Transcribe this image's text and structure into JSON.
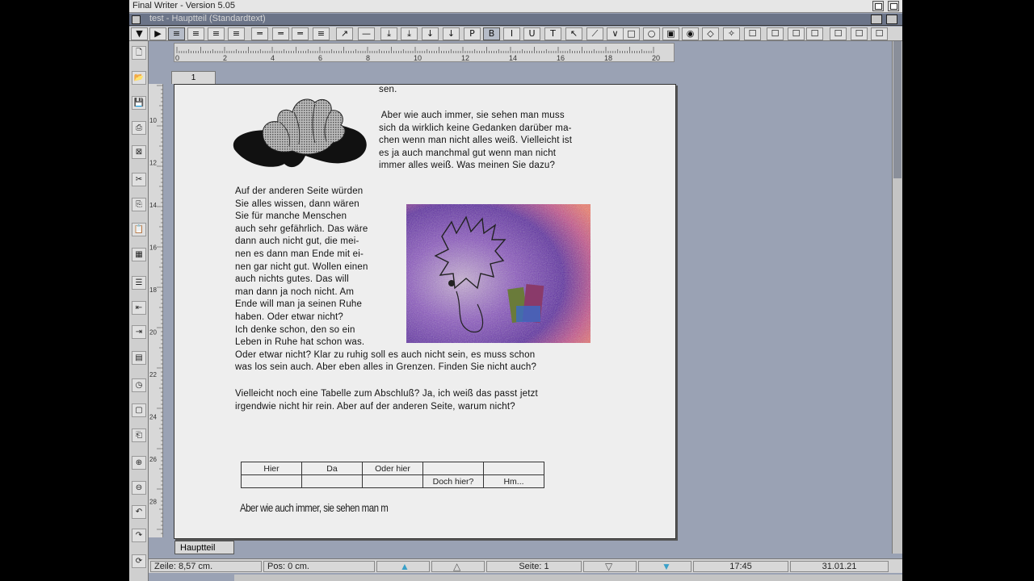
{
  "window": {
    "title": "Final Writer - Version 5.05"
  },
  "document": {
    "title": "test - Hauptteil (Standardtext)"
  },
  "toolbar": {
    "items": [
      "▼",
      "▶",
      "≡",
      "≡",
      "≡",
      "≡",
      "═",
      "═",
      "═",
      "≡",
      "↗",
      "—",
      "⤓",
      "⤓",
      "↓",
      "↓",
      "P",
      "B",
      "I",
      "U",
      "T",
      "↖",
      "⟋",
      "∨",
      "□",
      "○",
      "▣",
      "◉",
      "◇",
      "✧",
      "☐",
      "☐",
      "☐",
      "☐",
      "☐",
      "☐",
      "☐"
    ]
  },
  "ruler": {
    "labels": [
      "0",
      "2",
      "4",
      "6",
      "8",
      "10",
      "12",
      "14",
      "16",
      "18",
      "20"
    ]
  },
  "vruler": {
    "labels": [
      "10",
      "12",
      "14",
      "16",
      "18",
      "20",
      "22",
      "24",
      "26",
      "28"
    ]
  },
  "page_tab": "1",
  "text": {
    "top_fragment": "sen.",
    "para1": [
      " Aber wie auch immer, sie sehen man muss",
      "sich da wirklich keine Gedanken darüber ma-",
      "chen wenn man nicht alles weiß. Vielleicht ist",
      "es ja auch manchmal gut wenn man nicht",
      "immer alles weiß. Was meinen Sie dazu?"
    ],
    "para2": [
      "Auf der anderen Seite würden",
      "Sie alles wissen, dann wären",
      "Sie für manche Menschen",
      "auch sehr gefährlich. Das wäre",
      "dann auch nicht gut, die mei-",
      "nen es dann man Ende mit ei-",
      "nen gar nicht gut. Wollen einen",
      "auch nichts gutes. Das will",
      "man dann ja noch nicht. Am",
      "Ende will man ja seinen Ruhe",
      "haben. Oder etwar nicht?",
      "Ich denke schon, den so ein",
      "Leben in Ruhe hat schon was.",
      "Oder etwar nicht? Klar zu ruhig soll es auch nicht sein, es muss schon",
      "was los sein auch. Aber eben alles in Grenzen. Finden Sie nicht auch?"
    ],
    "para3": [
      "Vielleicht noch eine Tabelle zum Abschluß? Ja, ich weiß das passt jetzt",
      "irgendwie nicht hir rein. Aber auf der anderen Seite, warum nicht?"
    ],
    "bottom_line": "Aber wie auch immer, sie sehen man m"
  },
  "table": {
    "rows": [
      [
        "Hier",
        "Da",
        "Oder hier",
        "",
        ""
      ],
      [
        "",
        "",
        "",
        "Doch hier?",
        "Hm..."
      ]
    ]
  },
  "section_tab": "Hauptteil",
  "status": {
    "zeile": "Zeile: 8,57 cm.",
    "pos": "Pos: 0 cm.",
    "seite": "Seite: 1",
    "time": "17:45",
    "date": "31.01.21"
  },
  "colors": {
    "background": "#9aa2b4",
    "page": "#eeeeee",
    "docbar": "#6b7488",
    "accent_triangle": "#3aa0c8"
  }
}
